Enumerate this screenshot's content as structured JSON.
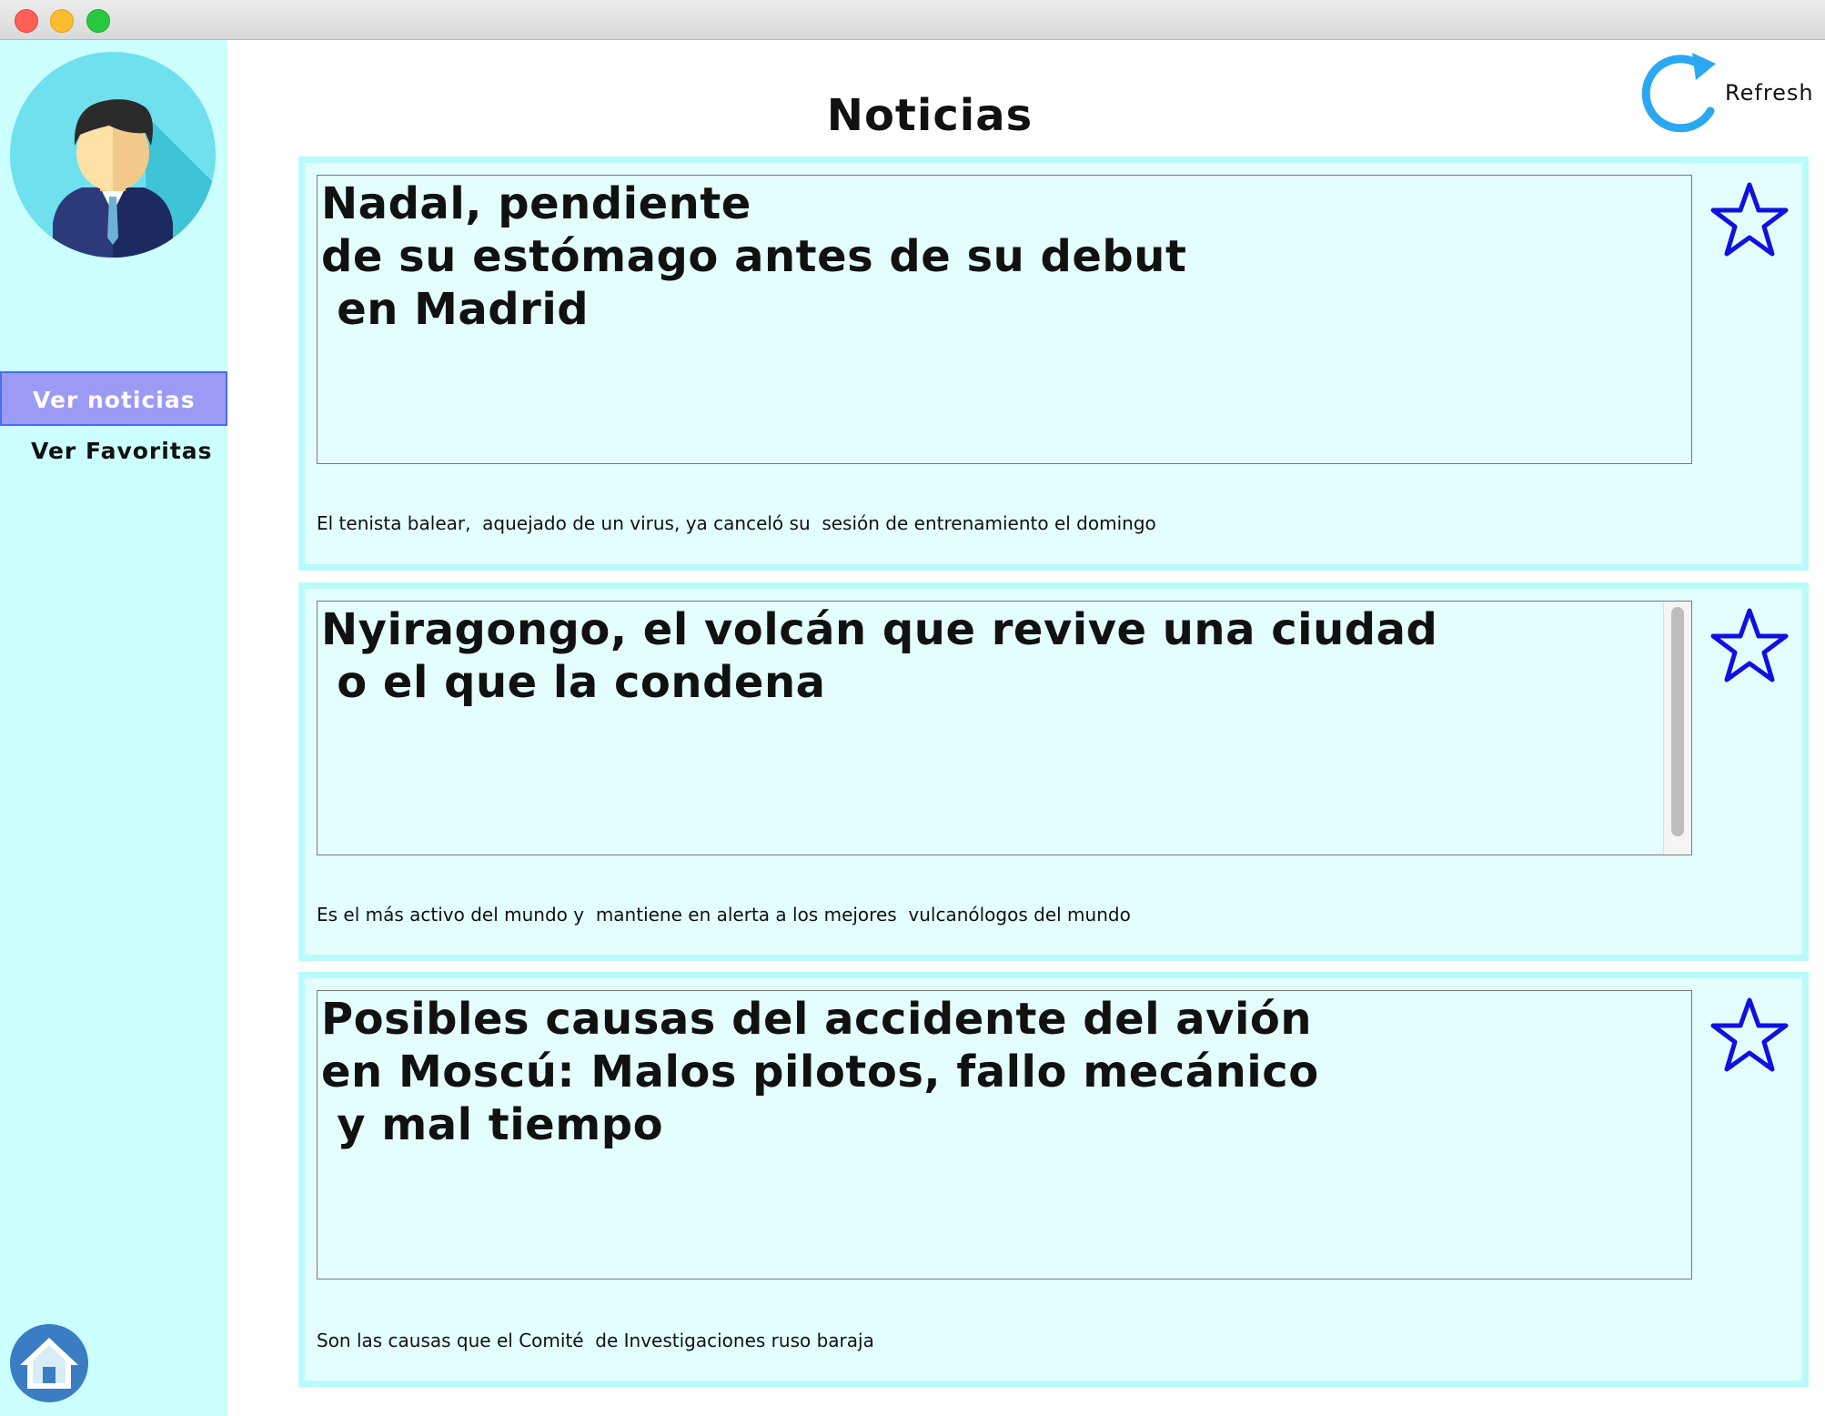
{
  "window": {
    "title": ""
  },
  "sidebar": {
    "nav": [
      {
        "label": "Ver noticias",
        "active": true
      },
      {
        "label": "Ver Favoritas",
        "active": false
      }
    ],
    "avatar_icon": "user-avatar-icon",
    "home_icon": "home-icon"
  },
  "header": {
    "title": "Noticias",
    "refresh_label": "Refresh",
    "refresh_icon": "refresh-icon"
  },
  "news": [
    {
      "headline": "Nadal, pendiente\nde su estómago antes de su debut\n en Madrid",
      "summary": "El tenista balear,  aquejado de un virus, ya canceló su  sesión de entrenamiento el domingo",
      "favorite": false
    },
    {
      "headline": "Nyiragongo, el volcán que revive una ciudad\n o el que la condena",
      "summary": "Es el más activo del mundo y  mantiene en alerta a los mejores  vulcanólogos del mundo",
      "favorite": false
    },
    {
      "headline": "Posibles causas del accidente del avión\nen Moscú: Malos pilotos, fallo mecánico\n y mal tiempo",
      "summary": "Son las causas que el Comité  de Investigaciones ruso baraja",
      "favorite": false
    }
  ],
  "colors": {
    "sidebar_bg": "#ccffff",
    "active_nav_bg": "#9b9bf5",
    "card_bg": "#e4fefe",
    "card_border": "#b9fafa",
    "star_outline": "#1010e0",
    "refresh_blue": "#2aa8f2"
  }
}
